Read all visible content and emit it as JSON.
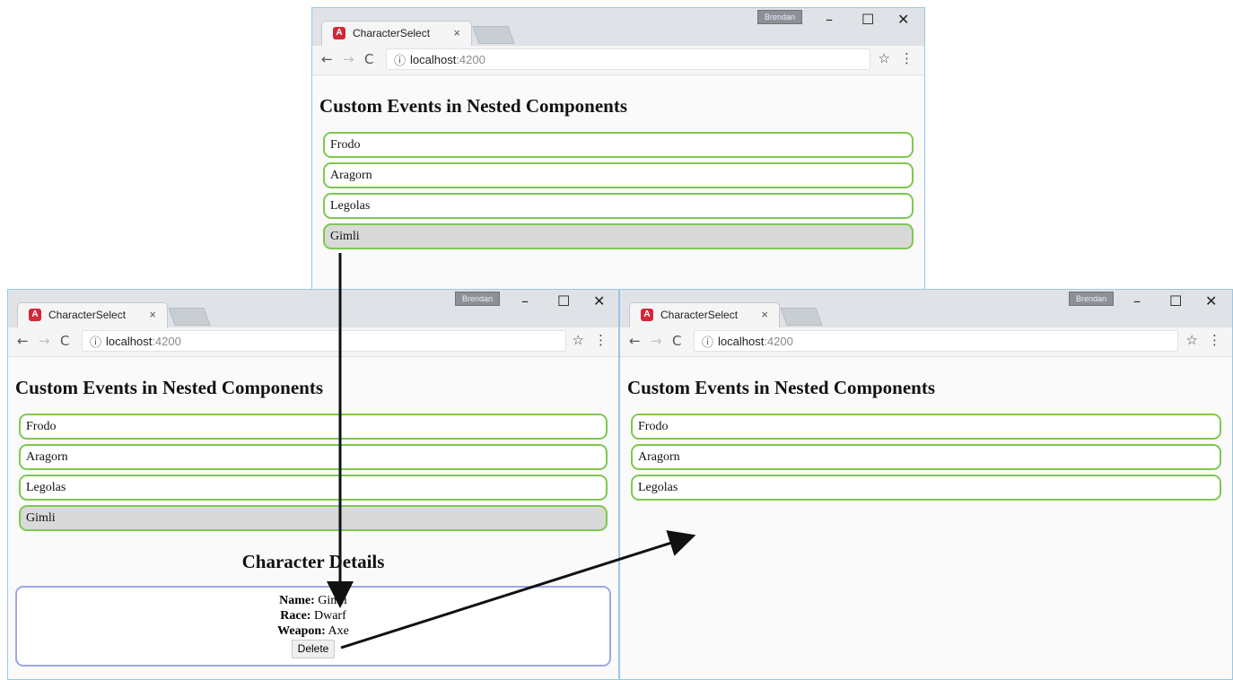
{
  "browser": {
    "tab_title": "CharacterSelect",
    "tab_close": "×",
    "favicon": "A",
    "profile": "Brendan",
    "minimize": "–",
    "maximize": "☐",
    "close": "✕",
    "back": "←",
    "forward": "→",
    "reload": "C",
    "info": "ⓘ",
    "url_host": "localhost",
    "url_port": ":4200",
    "star": "☆",
    "menu": "⋮"
  },
  "windows": {
    "top": {
      "heading": "Custom Events in Nested Components",
      "characters": [
        "Frodo",
        "Aragorn",
        "Legolas",
        "Gimli"
      ],
      "selected": "Gimli"
    },
    "left": {
      "heading": "Custom Events in Nested Components",
      "characters": [
        "Frodo",
        "Aragorn",
        "Legolas",
        "Gimli"
      ],
      "selected": "Gimli",
      "details": {
        "title": "Character Details",
        "name_label": "Name:",
        "name": "Gimli",
        "race_label": "Race:",
        "race": "Dwarf",
        "weapon_label": "Weapon:",
        "weapon": "Axe",
        "delete_label": "Delete"
      }
    },
    "right": {
      "heading": "Custom Events in Nested Components",
      "characters": [
        "Frodo",
        "Aragorn",
        "Legolas"
      ]
    }
  },
  "icons": [
    "angular-favicon-icon",
    "close-tab-icon",
    "back-arrow-icon",
    "forward-arrow-icon",
    "reload-icon",
    "info-icon",
    "star-icon",
    "menu-dots-icon",
    "minimize-icon",
    "maximize-icon",
    "close-window-icon"
  ]
}
